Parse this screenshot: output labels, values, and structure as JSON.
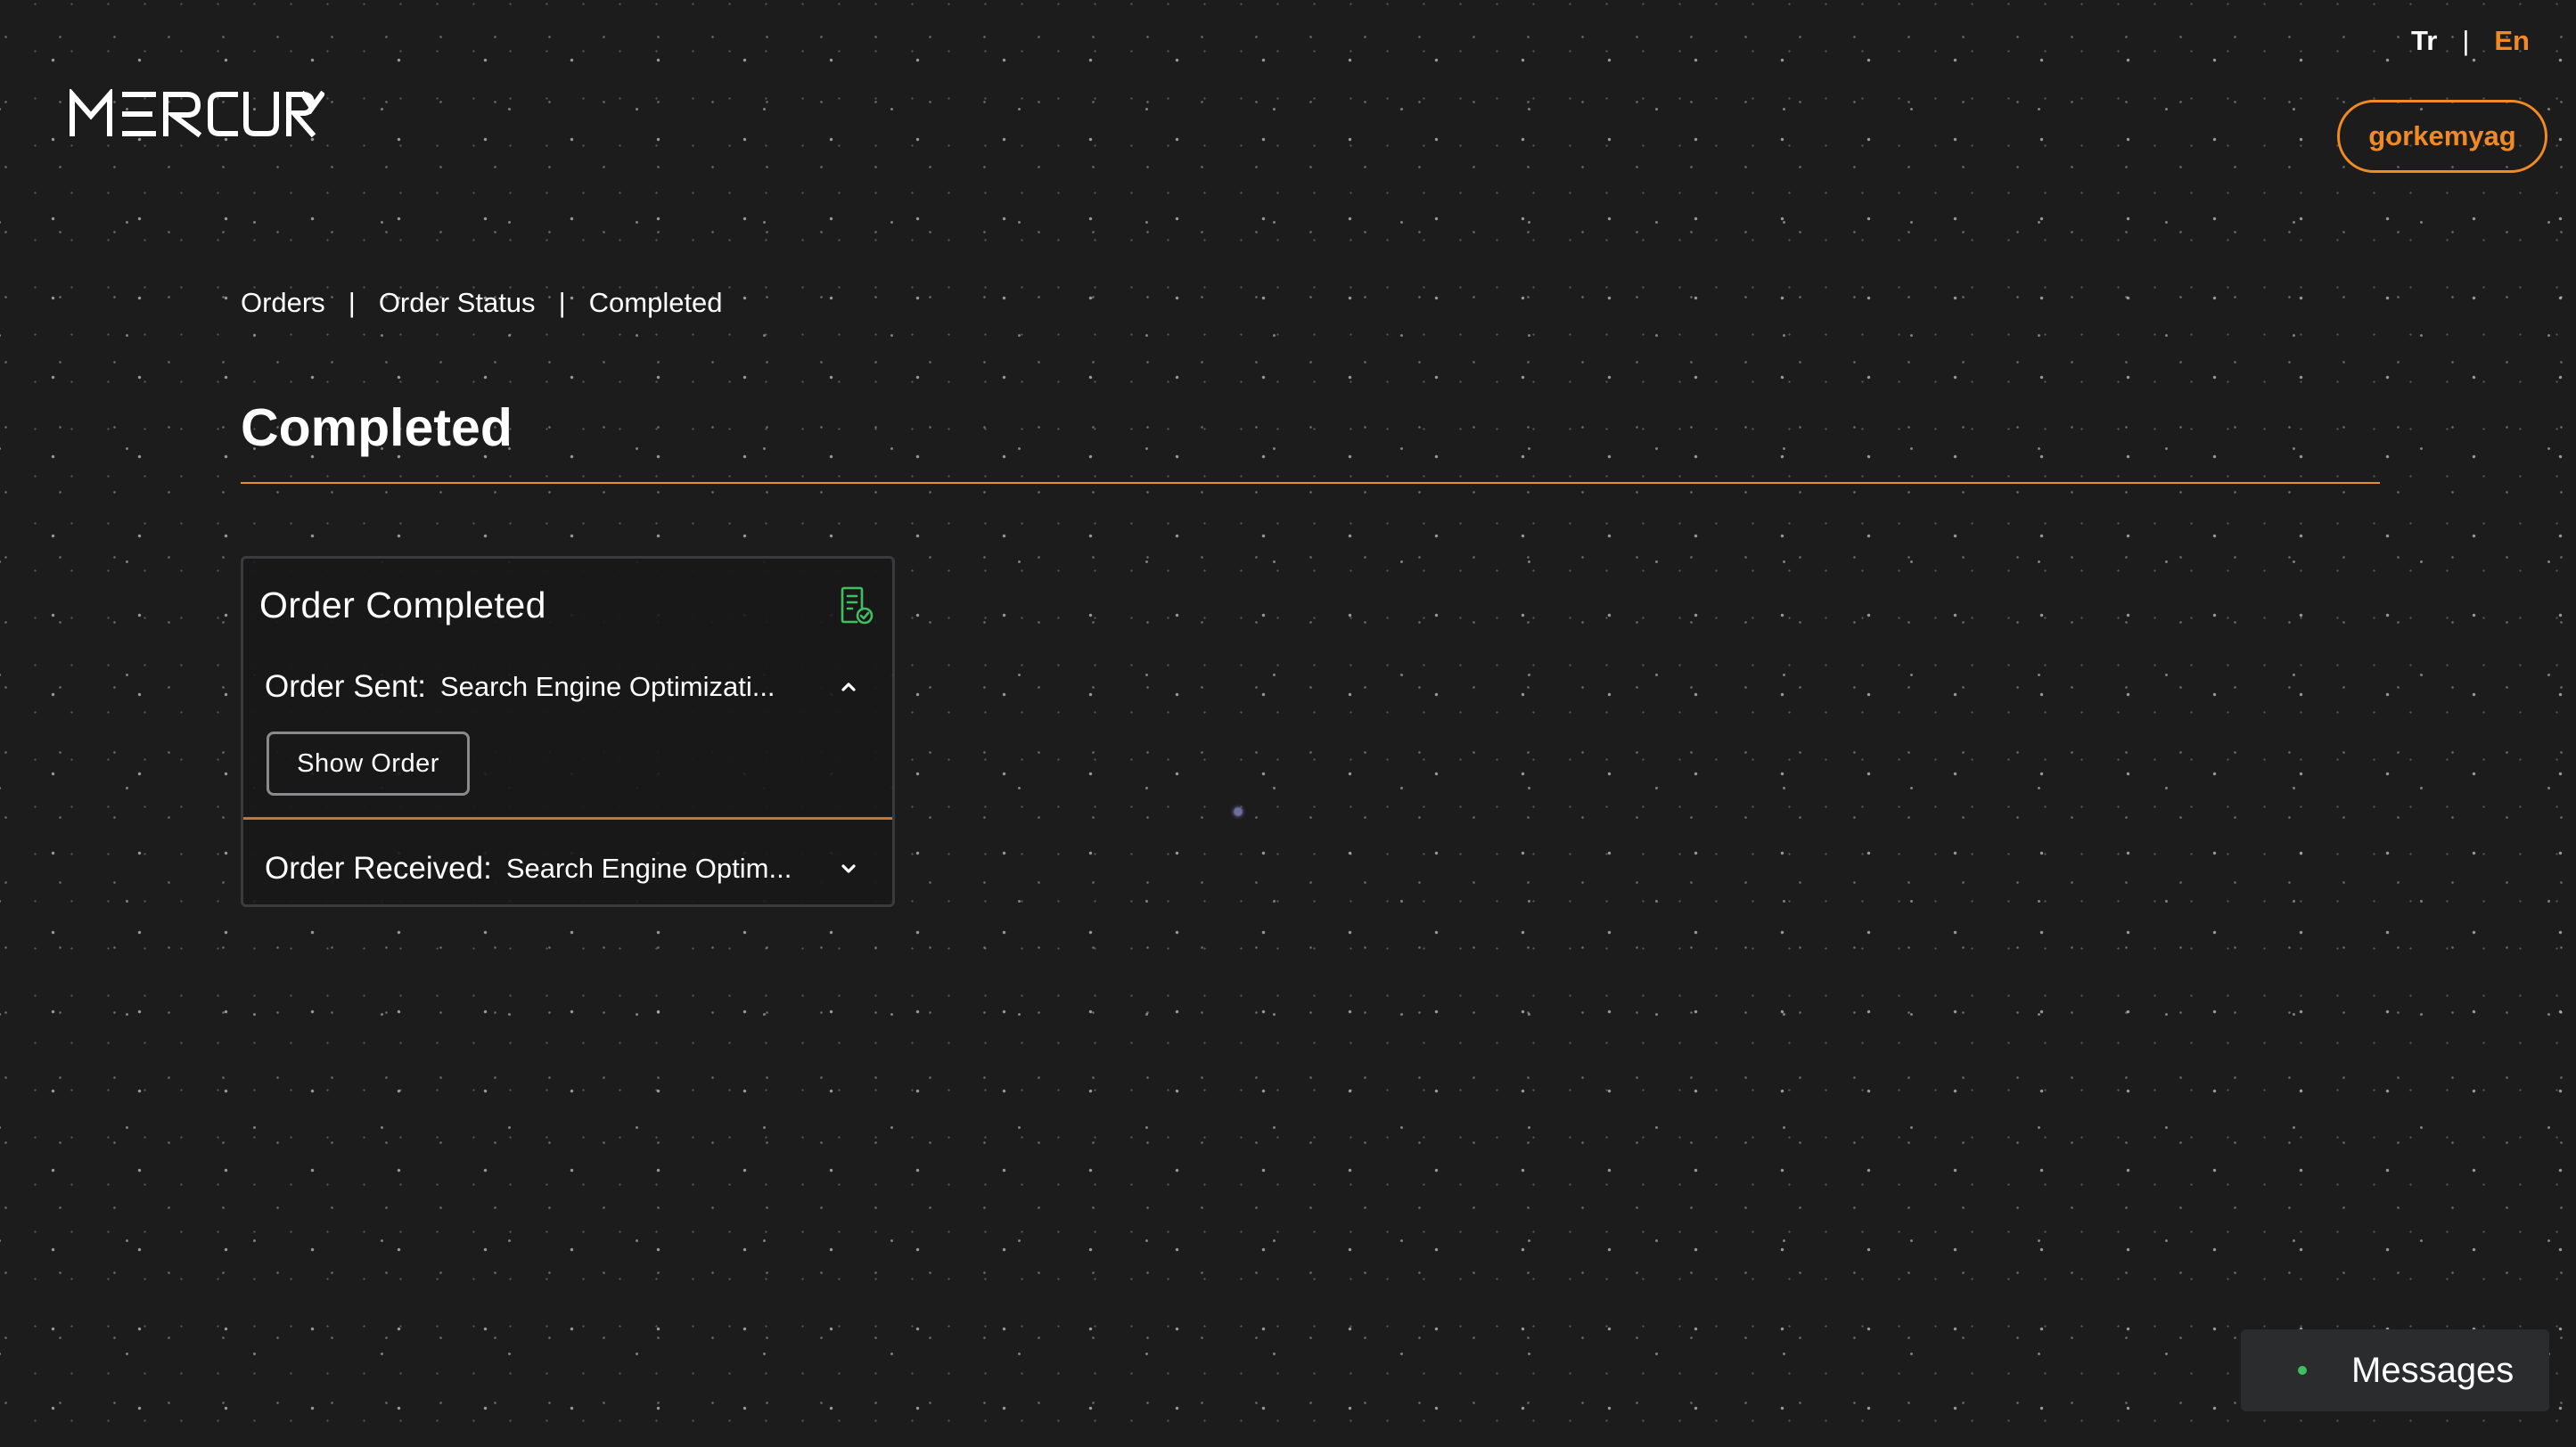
{
  "header": {
    "logo_text": "MERCURY",
    "lang_options": {
      "tr": "Tr",
      "separator": "|",
      "en": "En"
    },
    "active_lang": "En",
    "user_button": "gorkemyag"
  },
  "breadcrumb": {
    "items": [
      "Orders",
      "Order Status",
      "Completed"
    ],
    "separator": "|"
  },
  "page": {
    "title": "Completed"
  },
  "order_card": {
    "title": "Order Completed",
    "icon": "document-check-icon",
    "sent": {
      "label": "Order Sent:",
      "value": "Search Engine Optimizati...",
      "expanded": true
    },
    "show_order_label": "Show Order",
    "received": {
      "label": "Order Received:",
      "value": "Search Engine Optim...",
      "expanded": false
    }
  },
  "messages_widget": {
    "label": "Messages",
    "status": "online"
  },
  "colors": {
    "accent": "#f08a24",
    "background": "#1c1c1d",
    "card_border": "#3b3b3d",
    "icon_green": "#3fbf5f"
  }
}
